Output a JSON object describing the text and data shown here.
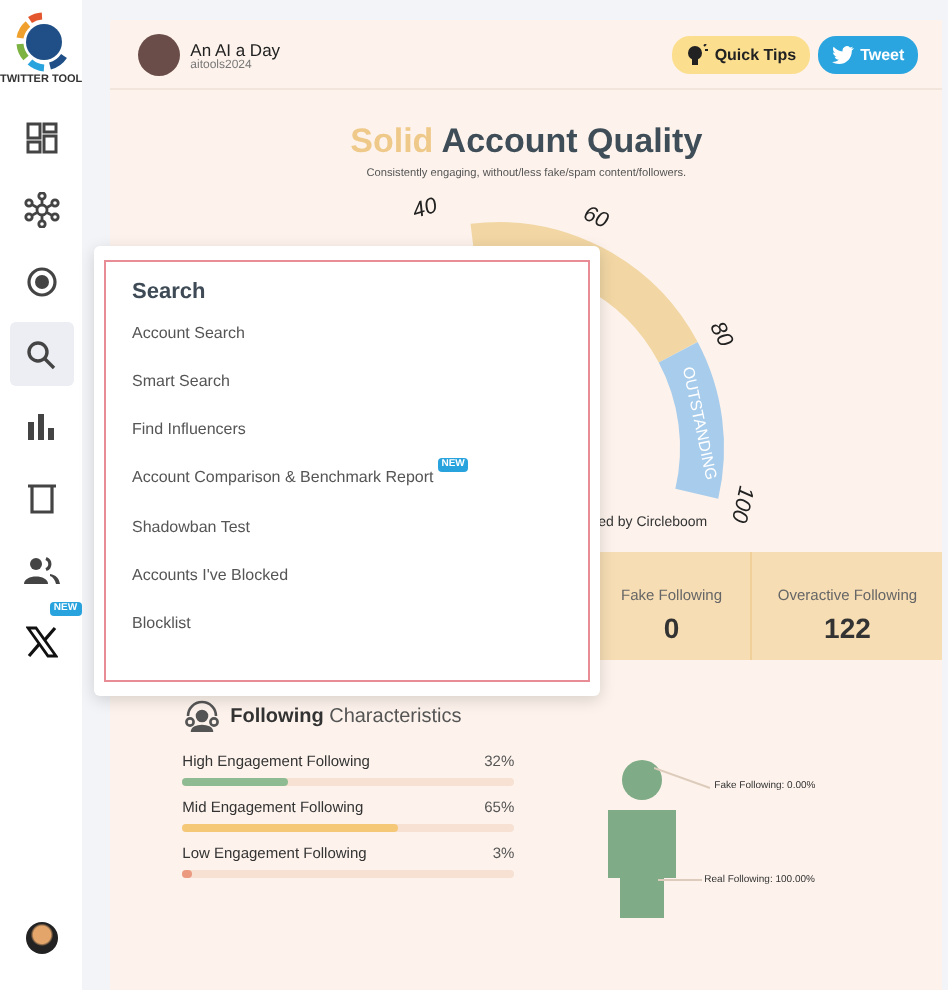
{
  "logo": {
    "text": "TWITTER TOOL"
  },
  "sidebar": {
    "items": [
      {
        "kind": "dashboard",
        "selected": false
      },
      {
        "kind": "network",
        "selected": false
      },
      {
        "kind": "record",
        "selected": false
      },
      {
        "kind": "search",
        "selected": true
      },
      {
        "kind": "chart",
        "selected": false
      },
      {
        "kind": "trash",
        "selected": false
      },
      {
        "kind": "users",
        "selected": false
      },
      {
        "kind": "x",
        "selected": false,
        "badge": "NEW"
      }
    ]
  },
  "header": {
    "name": "An AI a Day",
    "handle": "aitools2024",
    "quick_tips": "Quick Tips",
    "tweet": "Tweet"
  },
  "quality": {
    "highlight": "Solid",
    "title": "Account Quality",
    "subtitle": "Consistently engaging, without/less fake/spam content/followers.",
    "gauge": {
      "ticks": [
        "40",
        "60",
        "80",
        "100"
      ],
      "band_label": "OUTSTANDING",
      "caption": "ed by Circleboom"
    }
  },
  "stats": [
    {
      "label": "Fake Following",
      "value": "0"
    },
    {
      "label": "Overactive Following",
      "value": "122"
    }
  ],
  "following": {
    "title_bold": "Following",
    "title": "Characteristics",
    "bars": [
      {
        "label": "High Engagement Following",
        "reading": "32%",
        "level": 0.32,
        "color": "#8fbb92"
      },
      {
        "label": "Mid Engagement Following",
        "reading": "65%",
        "level": 0.65,
        "color": "#f5c878"
      },
      {
        "label": "Low Engagement Following",
        "reading": "3%",
        "level": 0.03,
        "color": "#eb9a80"
      }
    ],
    "figure_labels": [
      "Fake Following: 0.00%",
      "Real Following: 100.00%"
    ]
  },
  "popup": {
    "title": "Search",
    "items": [
      {
        "label": "Account Search"
      },
      {
        "label": "Smart Search"
      },
      {
        "label": "Find Influencers"
      },
      {
        "label": "Account Comparison & Benchmark Report",
        "badge": "NEW"
      },
      {
        "label": "Shadowban Test"
      },
      {
        "label": "Accounts I've Blocked"
      },
      {
        "label": "Blocklist"
      }
    ]
  }
}
